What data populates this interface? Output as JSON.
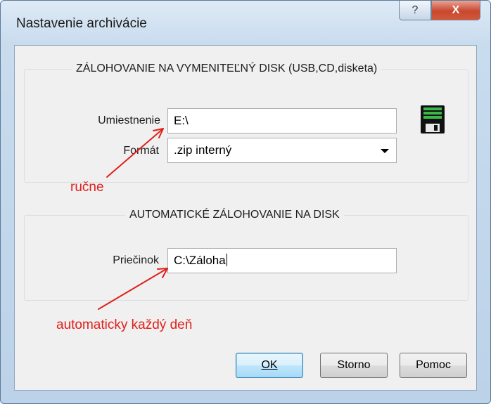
{
  "window": {
    "title": "Nastavenie archivácie",
    "help_glyph": "?",
    "close_glyph": "X"
  },
  "removable": {
    "group_title": "ZÁLOHOVANIE NA VYMENITEĽNÝ DISK (USB,CD,disketa)",
    "location_label": "Umiestnenie",
    "location_value": "E:\\",
    "format_label": "Formát",
    "format_value": ".zip  interný"
  },
  "auto": {
    "group_title": "AUTOMATICKÉ ZÁLOHOVANIE NA DISK",
    "folder_label": "Priečinok",
    "folder_value": "C:\\Záloha"
  },
  "annotations": {
    "manual": "ručne",
    "automatic": "automaticky každý deň",
    "color": "#e0201a"
  },
  "buttons": {
    "ok": "OK",
    "cancel": "Storno",
    "help": "Pomoc"
  }
}
